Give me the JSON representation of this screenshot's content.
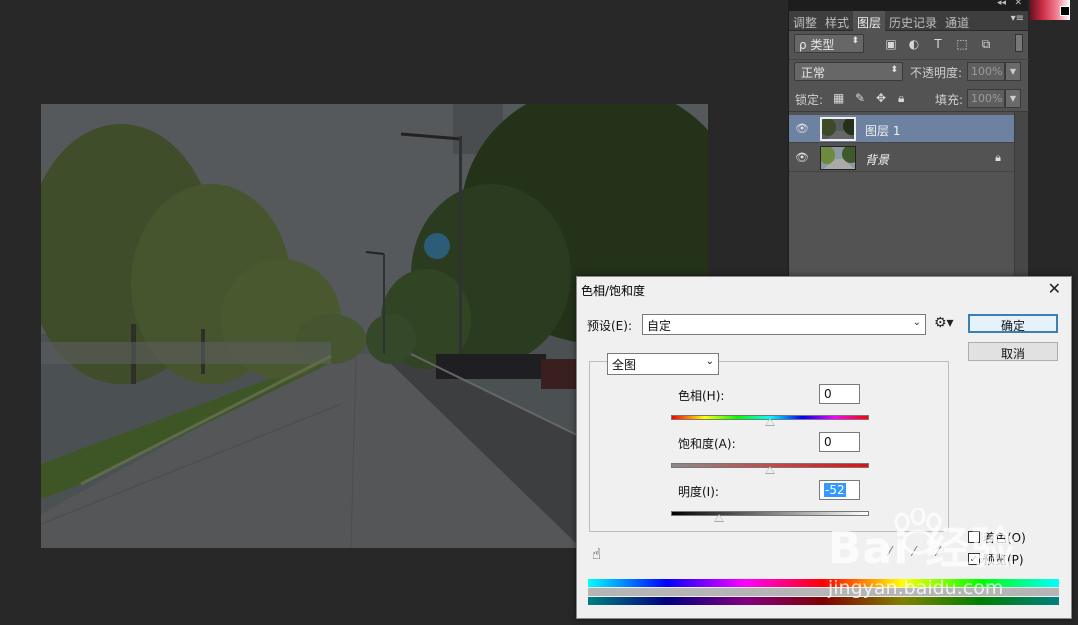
{
  "layers_panel": {
    "tabs": [
      {
        "label": "调整",
        "active": false
      },
      {
        "label": "样式",
        "active": false
      },
      {
        "label": "图层",
        "active": true
      },
      {
        "label": "历史记录",
        "active": false
      },
      {
        "label": "通道",
        "active": false
      }
    ],
    "collapse_icon": "double-chevron-left-icon",
    "close_icon": "close-icon",
    "filter_type": "ρ 类型",
    "filter_icons": [
      "image-filter-icon",
      "adjustment-filter-icon",
      "type-filter-icon",
      "shape-filter-icon",
      "smart-object-filter-icon"
    ],
    "blend_mode": "正常",
    "opacity_label": "不透明度:",
    "opacity_value": "100%",
    "lock_label": "锁定:",
    "fill_label": "填充:",
    "fill_value": "100%",
    "layers": [
      {
        "name": "图层 1",
        "selected": true,
        "locked": false
      },
      {
        "name": "背景",
        "selected": false,
        "locked": true
      }
    ]
  },
  "dialog": {
    "title": "色相/饱和度",
    "preset_label": "预设(E):",
    "preset_value": "自定",
    "ok_label": "确定",
    "cancel_label": "取消",
    "channel": "全图",
    "hue_label": "色相(H):",
    "hue_value": "0",
    "saturation_label": "饱和度(A):",
    "saturation_value": "0",
    "lightness_label": "明度(I):",
    "lightness_value": "-52",
    "colorize_label": "着色(O)",
    "colorize_checked": false,
    "preview_label": "预览(P)",
    "preview_checked": true,
    "slider_levels": {
      "hue": 0.5,
      "saturation": 0.5,
      "lightness": 0.24
    }
  },
  "watermark": {
    "logo": "Bai 经验",
    "url": "jingyan.baidu.com"
  }
}
